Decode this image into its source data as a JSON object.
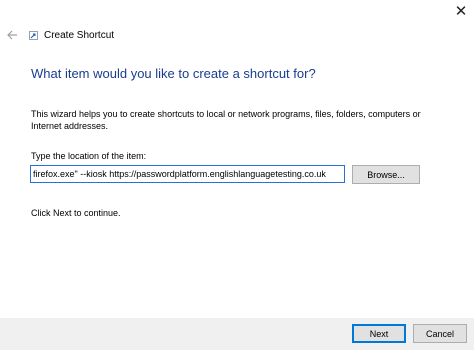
{
  "window": {
    "close_glyph": "✕"
  },
  "header": {
    "title": "Create Shortcut",
    "back_icon": "back-arrow-icon",
    "wizard_icon": "shortcut-icon"
  },
  "main": {
    "heading": "What item would you like to create a shortcut for?",
    "description": "This wizard helps you to create shortcuts to local or network programs, files, folders, computers or Internet addresses.",
    "location_label": "Type the location of the item:",
    "location_value": "firefox.exe\" --kiosk https://passwordplatform.englishlanguagetesting.co.uk",
    "browse_label": "Browse...",
    "continue_text": "Click Next to continue."
  },
  "footer": {
    "next_label": "Next",
    "cancel_label": "Cancel"
  },
  "colors": {
    "heading": "#1a3d8f",
    "focus_border": "#2a6fd6",
    "footer_bg": "#f0f0f0",
    "button_bg": "#e1e1e1"
  }
}
